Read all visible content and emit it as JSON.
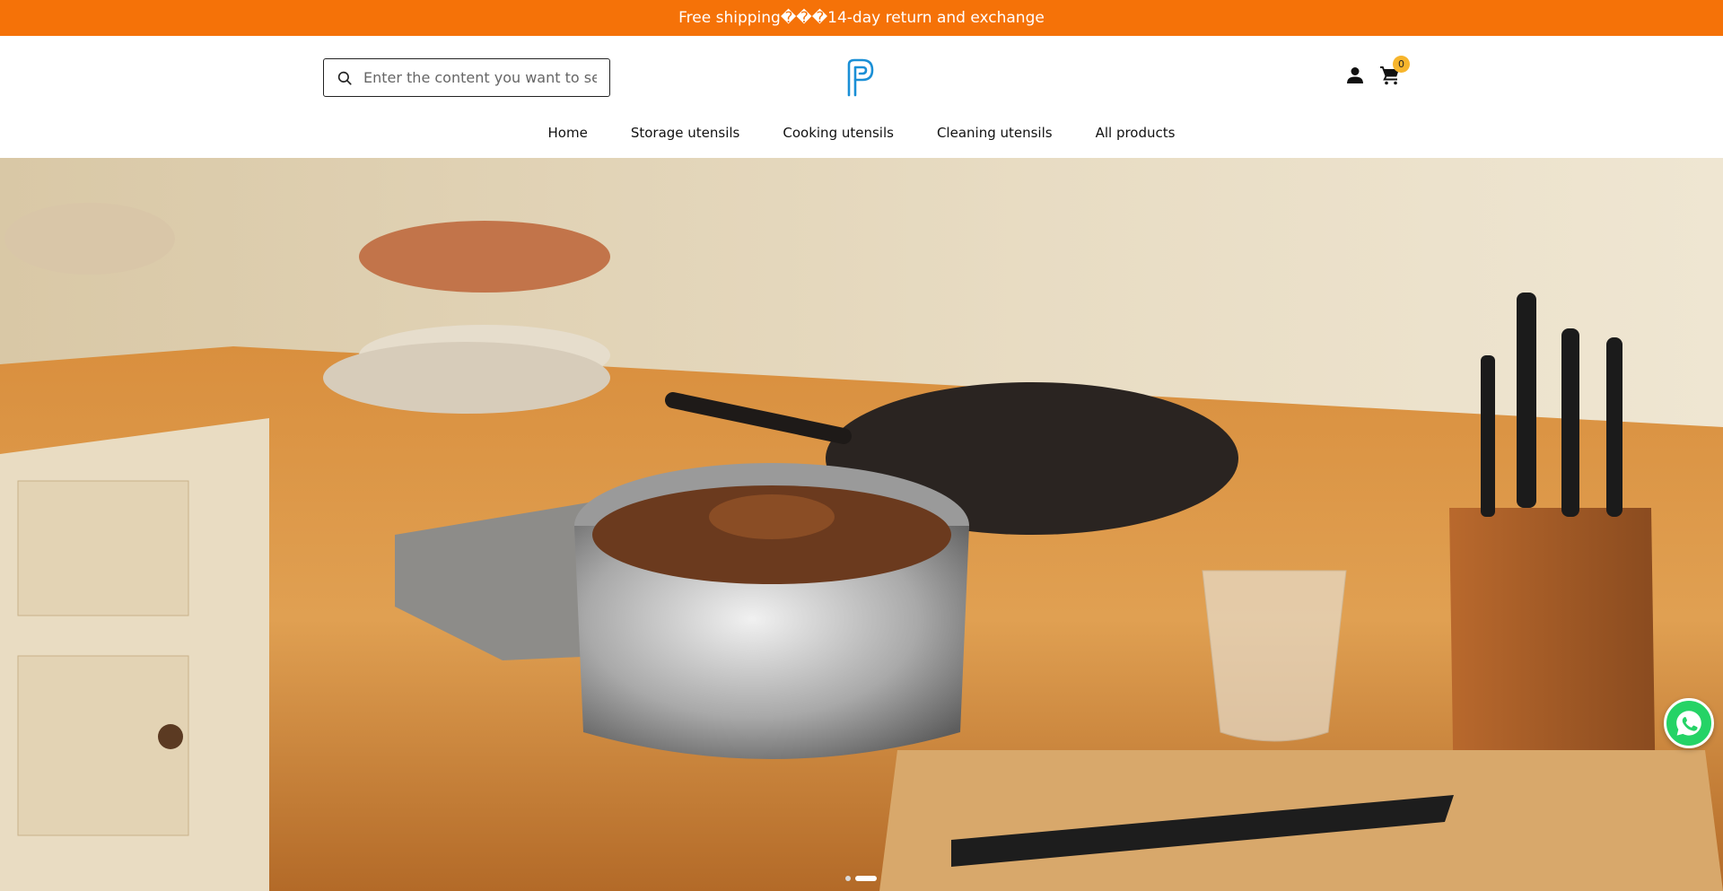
{
  "announcement": {
    "text": "Free shipping���14-day return and exchange",
    "background": "#f57208"
  },
  "header": {
    "search": {
      "placeholder": "Enter the content you want to se",
      "icon": "search-icon"
    },
    "logo": {
      "icon": "brand-logo-icon",
      "color": "#1a8fd6"
    },
    "account": {
      "icon": "user-icon"
    },
    "cart": {
      "icon": "cart-icon",
      "count": "0",
      "badge_color": "#f7b52c"
    }
  },
  "nav": {
    "items": [
      {
        "label": "Home"
      },
      {
        "label": "Storage utensils"
      },
      {
        "label": "Cooking utensils"
      },
      {
        "label": "Cleaning utensils"
      },
      {
        "label": "All products"
      }
    ]
  },
  "hero": {
    "image": "kitchen-countertop-photo",
    "slides": {
      "count": 2,
      "active": 2
    }
  },
  "floating": {
    "whatsapp": {
      "icon": "whatsapp-icon",
      "color": "#25d366"
    }
  }
}
